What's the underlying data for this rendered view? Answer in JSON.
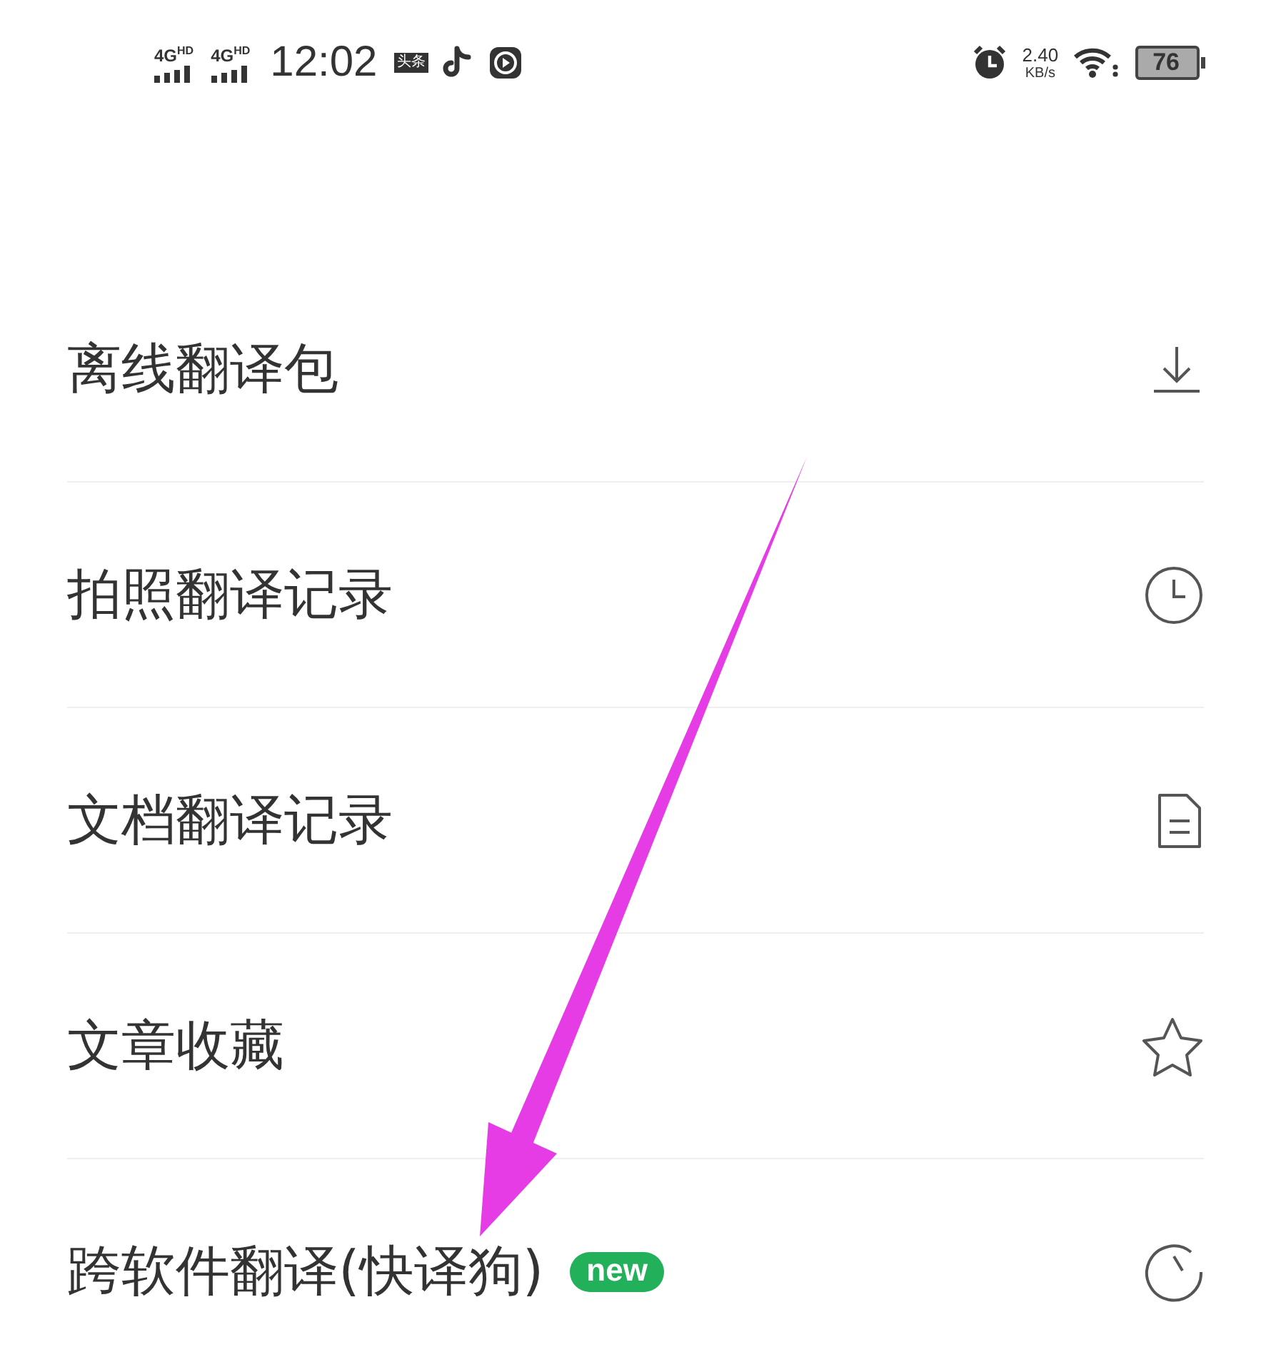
{
  "status_bar": {
    "networks": [
      {
        "label": "4G",
        "sup": "HD"
      },
      {
        "label": "4G",
        "sup": "HD"
      }
    ],
    "time": "12:02",
    "app_badge": "头条",
    "speed_value": "2.40",
    "speed_unit": "KB/s",
    "battery": "76"
  },
  "menu": [
    {
      "label": "离线翻译包",
      "kind": "download"
    },
    {
      "label": "拍照翻译记录",
      "kind": "history"
    },
    {
      "label": "文档翻译记录",
      "kind": "document"
    },
    {
      "label": "文章收藏",
      "kind": "favorite"
    },
    {
      "label": "跨软件翻译(快译狗)",
      "kind": "crossapp",
      "badge": "new"
    }
  ],
  "annotation": {
    "kind": "arrow"
  }
}
